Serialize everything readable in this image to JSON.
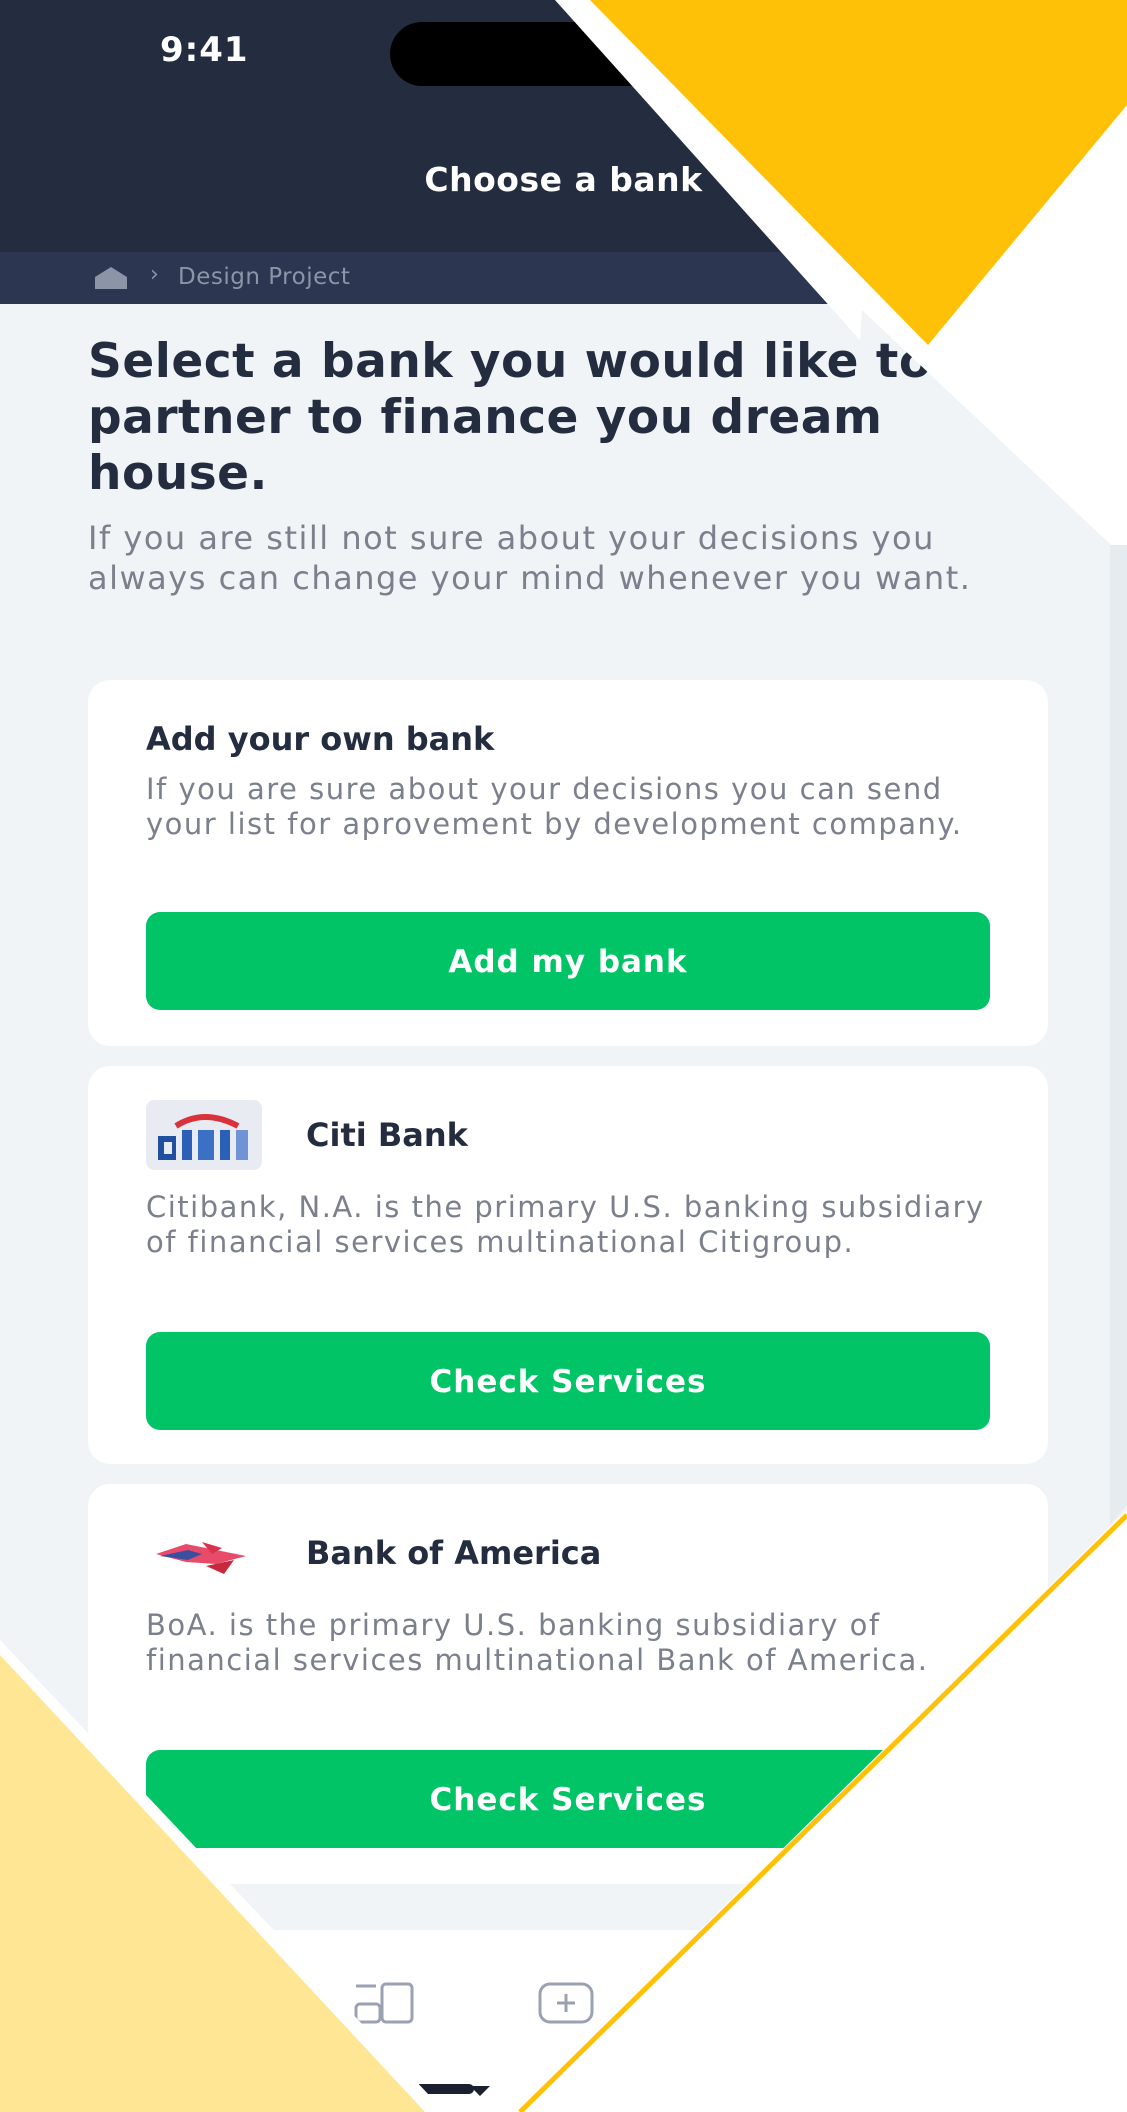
{
  "status_bar": {
    "time": "9:41"
  },
  "header": {
    "title": "Choose a bank"
  },
  "breadcrumb": {
    "separator": "›",
    "current": "Design Project"
  },
  "intro": {
    "title": "Select a bank you would like to partner to finance you dream house.",
    "description": "If you are still not sure about your decisions you always can change your mind whenever you want."
  },
  "own_bank_card": {
    "title": "Add your own bank",
    "description": "If you are sure about your decisions you can send your list for aprovement by development company.",
    "button_label": "Add my bank"
  },
  "banks": [
    {
      "name": "Citi Bank",
      "logo_icon": "citi-logo-icon",
      "description": "Citibank, N.A. is the primary U.S. banking subsidiary of financial services multinational Citigroup.",
      "button_label": "Check Services"
    },
    {
      "name": "Bank of America",
      "logo_icon": "boa-logo-icon",
      "description": "BoA. is the primary U.S. banking subsidiary of financial services multinational Bank of America.",
      "button_label": "Check Services"
    }
  ],
  "tabbar": {
    "icons": [
      "home-icon",
      "catalog-icon",
      "add-icon"
    ]
  },
  "colors": {
    "header_bg": "#242c40",
    "page_bg": "#f1f4f7",
    "accent_green": "#00c466",
    "overlay_yellow": "#ffc107",
    "overlay_pale_yellow": "#ffe48c"
  }
}
